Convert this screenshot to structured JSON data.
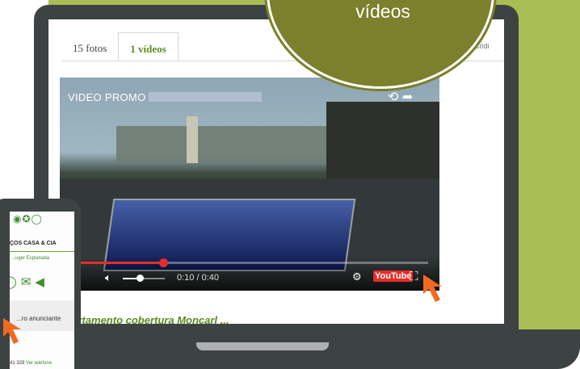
{
  "badge": {
    "text": "vídeos"
  },
  "listing_page": {
    "tabs": [
      {
        "label": "15 fotos",
        "active": false
      },
      {
        "label": "1 vídeos",
        "active": true
      }
    ],
    "tab_right_text": "Códi",
    "below_video_text": "apartamento cobertura Moncarl ...",
    "accent_color": "#5c8a1f"
  },
  "video_player": {
    "title": "VIDEO PROMO",
    "time_display": "0:10 / 0:40",
    "progress": 0.28,
    "volume": 0.4,
    "youtube_logo": "YouTube",
    "icons": [
      "play-icon",
      "volume-icon",
      "settings-icon",
      "fullscreen-icon",
      "share-icon"
    ]
  },
  "mobile": {
    "nav_text": "ÇOS   CASA & CIA",
    "sub_text": "...uger Esplanada",
    "card_text": "...ro anunciante",
    "phone_number": "41 329",
    "phone_link": "Ver telefone"
  },
  "colors": {
    "background_green": "#a8bd53",
    "badge_olive": "#7c7f2b",
    "device_gray": "#3d4343",
    "cursor_orange": "#f26a21"
  }
}
